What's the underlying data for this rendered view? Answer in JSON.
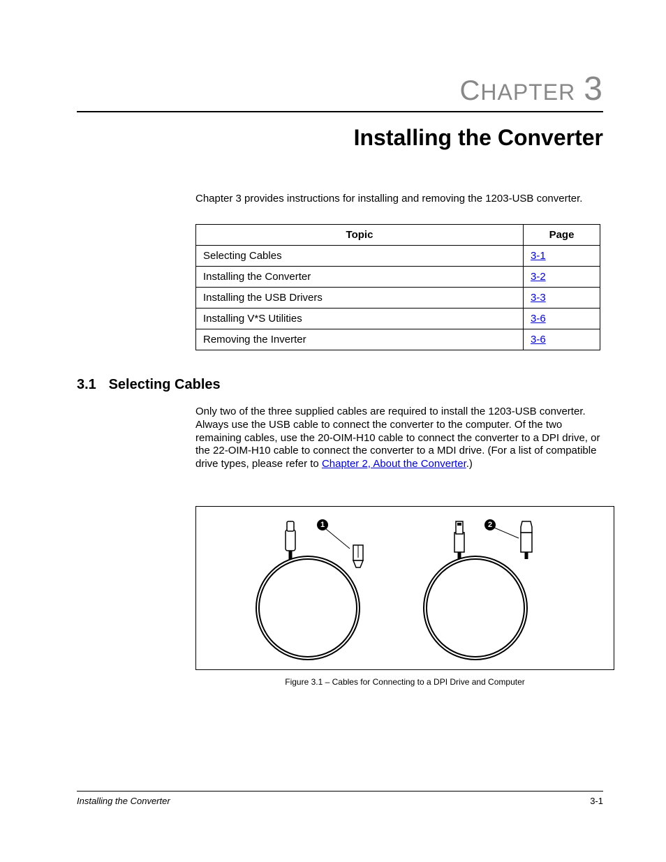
{
  "chapter": {
    "label_prefix": "C",
    "label_rest": "HAPTER",
    "number": "3"
  },
  "title": "Installing the Converter",
  "intro": "Chapter 3 provides instructions for installing and removing the 1203-USB converter.",
  "table": {
    "headers": {
      "topic": "Topic",
      "page": "Page"
    },
    "rows": [
      {
        "topic": "Selecting Cables",
        "page": "3-1"
      },
      {
        "topic": "Installing the Converter",
        "page": "3-2"
      },
      {
        "topic": "Installing the USB Drivers",
        "page": "3-3"
      },
      {
        "topic": "Installing V*S Utilities",
        "page": "3-6"
      },
      {
        "topic": "Removing the Inverter",
        "page": "3-6"
      }
    ]
  },
  "section": {
    "number": "3.1",
    "title": "Selecting Cables",
    "body_pre": "Only two of the three supplied cables are required to install the 1203-USB converter. Always use the USB cable to connect the converter to the computer. Of the two remaining cables, use the 20-OIM-H10 cable to connect the converter to a DPI drive, or the 22-OIM-H10 cable to connect the converter to a MDI drive. (For a list of compatible drive types, please refer to ",
    "body_link": "Chapter 2, About the Converter",
    "body_post": ".)"
  },
  "figure": {
    "callouts": {
      "one": "1",
      "two": "2"
    },
    "caption": "Figure 3.1 – Cables for Connecting to a DPI Drive and Computer"
  },
  "footer": {
    "left": "Installing the Converter",
    "right": "3-1"
  }
}
